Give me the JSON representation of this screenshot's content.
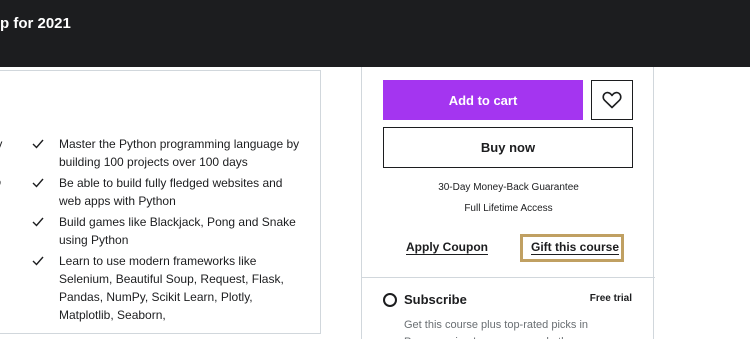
{
  "header": {
    "title": "p for 2021"
  },
  "learn": {
    "fragments": [
      "lly",
      "to",
      "d"
    ],
    "items": [
      {
        "text": "Master the Python programming language by building 100 projects over 100 days"
      },
      {
        "text": "Be able to build fully fledged websites and web apps with Python"
      },
      {
        "text": "Build games like Blackjack, Pong and Snake using Python"
      },
      {
        "text": "Learn to use modern frameworks like Selenium, Beautiful Soup, Request, Flask, Pandas, NumPy, Scikit Learn, Plotly, Matplotlib, Seaborn,"
      }
    ]
  },
  "sidebar": {
    "add_to_cart": "Add to cart",
    "wishlist_icon": "heart-icon",
    "buy_now": "Buy now",
    "guarantee": "30-Day Money-Back Guarantee",
    "lifetime": "Full Lifetime Access",
    "apply_coupon": "Apply Coupon",
    "gift_course": "Gift this course",
    "subscribe": {
      "title": "Subscribe",
      "badge": "Free trial",
      "description": "Get this course plus top-rated picks in Programming Languages and other"
    }
  },
  "colors": {
    "accent": "#a435f0",
    "topbar": "#1c1d1f",
    "focus_ring": "#c0a062"
  }
}
